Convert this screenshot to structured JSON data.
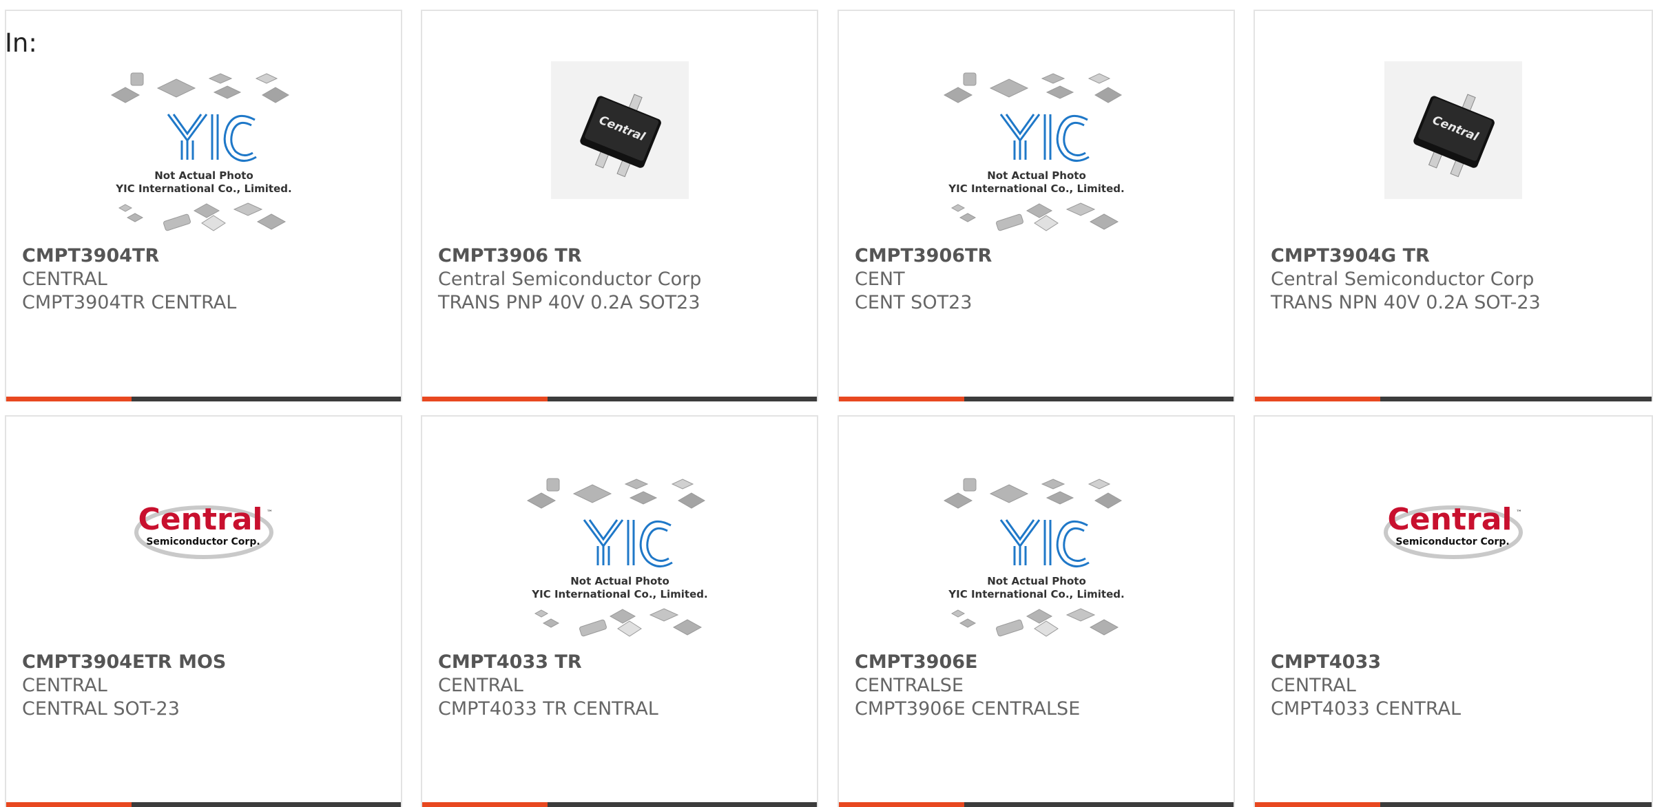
{
  "filter_label": "In:",
  "image_text": {
    "yic_logo": "YIC",
    "yic_caption_line1": "Not Actual Photo",
    "yic_caption_line2": "YIC International Co., Limited.",
    "central_logo_main": "Central",
    "central_logo_sub": "Semiconductor Corp.",
    "central_logo_tm": "™",
    "chip_label": "Central"
  },
  "colors": {
    "accent_orange": "#e84820",
    "bar_dark": "#3c3c3c",
    "central_red": "#c8102e",
    "yic_blue": "#1f78c8"
  },
  "products": [
    {
      "part": "CMPT3904TR",
      "manufacturer": "CENTRAL",
      "description": "CMPT3904TR CENTRAL",
      "image": "yic-placeholder"
    },
    {
      "part": "CMPT3906 TR",
      "manufacturer": "Central Semiconductor Corp",
      "description": "TRANS PNP 40V 0.2A SOT23",
      "image": "sot23-chip"
    },
    {
      "part": "CMPT3906TR",
      "manufacturer": "CENT",
      "description": "CENT SOT23",
      "image": "yic-placeholder"
    },
    {
      "part": "CMPT3904G TR",
      "manufacturer": "Central Semiconductor Corp",
      "description": "TRANS NPN 40V 0.2A SOT-23",
      "image": "sot23-chip"
    },
    {
      "part": "CMPT3904ETR MOS",
      "manufacturer": "CENTRAL",
      "description": "CENTRAL SOT-23",
      "image": "central-logo"
    },
    {
      "part": "CMPT4033 TR",
      "manufacturer": "CENTRAL",
      "description": "CMPT4033 TR CENTRAL",
      "image": "yic-placeholder"
    },
    {
      "part": "CMPT3906E",
      "manufacturer": "CENTRALSE",
      "description": "CMPT3906E CENTRALSE",
      "image": "yic-placeholder"
    },
    {
      "part": "CMPT4033",
      "manufacturer": "CENTRAL",
      "description": "CMPT4033 CENTRAL",
      "image": "central-logo"
    }
  ]
}
